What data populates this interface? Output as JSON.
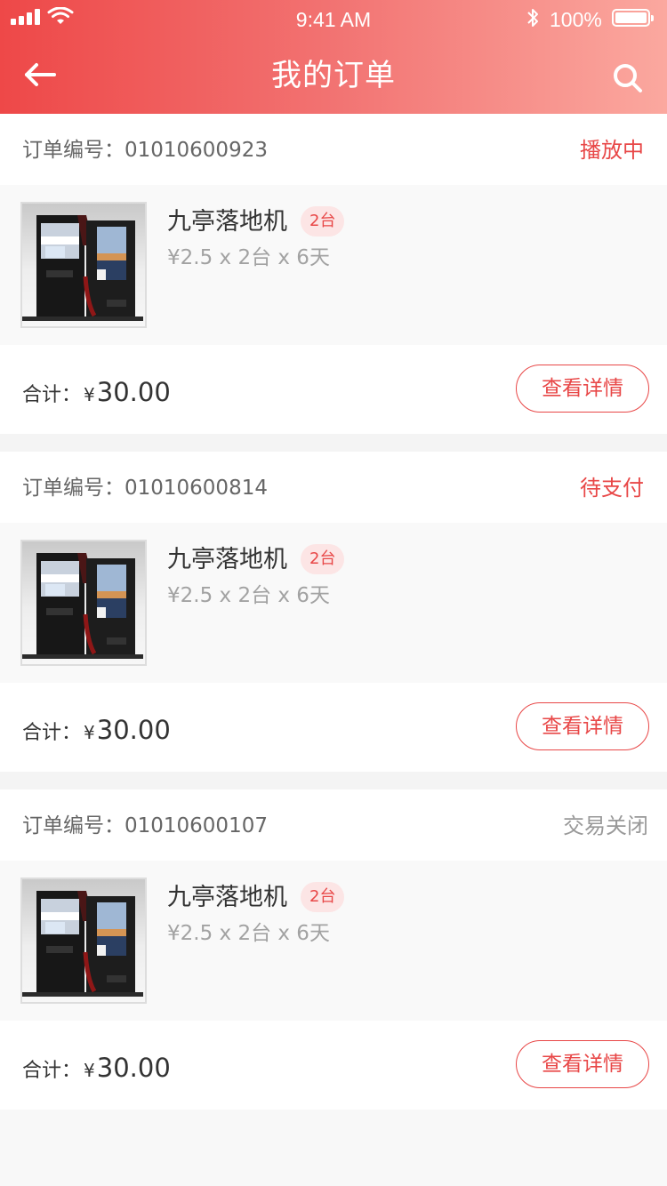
{
  "status_bar": {
    "time": "9:41 AM",
    "battery": "100%"
  },
  "header": {
    "title": "我的订单",
    "back_icon": "back-arrow-icon",
    "search_icon": "search-icon"
  },
  "colors": {
    "accent": "#e84747",
    "muted": "#999999",
    "badge_bg": "#fce5e5"
  },
  "orders": [
    {
      "order_no": "订单编号：01010600923",
      "status": "播放中",
      "product": "九亭落地机",
      "qty_badge": "2台",
      "detail": "¥2.5 x 2台 x 6天",
      "total_label": "合计：",
      "currency": "¥",
      "amount": "30.00",
      "button": "查看详情"
    },
    {
      "order_no": "订单编号：01010600814",
      "status": "待支付",
      "product": "九亭落地机",
      "qty_badge": "2台",
      "detail": "¥2.5 x 2台 x 6天",
      "total_label": "合计：",
      "currency": "¥",
      "amount": "30.00",
      "button": "查看详情"
    },
    {
      "order_no": "订单编号：01010600107",
      "status": "交易关闭",
      "product": "九亭落地机",
      "qty_badge": "2台",
      "detail": "¥2.5 x 2台 x 6天",
      "total_label": "合计：",
      "currency": "¥",
      "amount": "30.00",
      "button": "查看详情"
    }
  ]
}
